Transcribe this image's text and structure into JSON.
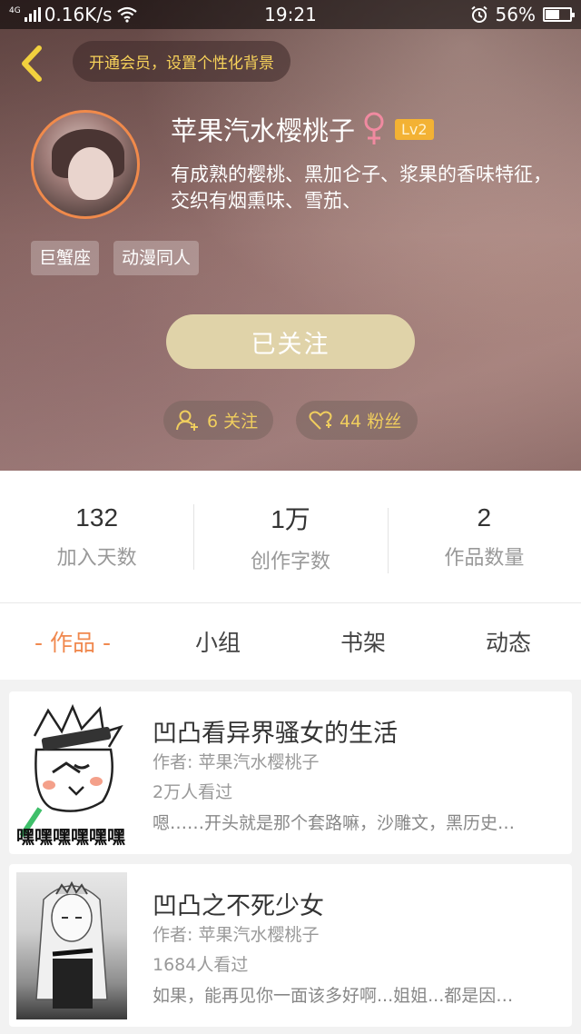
{
  "status_bar": {
    "network": "4G",
    "speed": "0.16K/s",
    "time": "19:21",
    "battery": "56%"
  },
  "header": {
    "vip_prompt": "开通会员，设置个性化背景",
    "username": "苹果汽水樱桃子",
    "level": "Lv2",
    "bio": "有成熟的樱桃、黑加仑子、浆果的香味特征，交织有烟熏味、雪茄、",
    "tags": [
      "巨蟹座",
      "动漫同人"
    ],
    "follow_button": "已关注",
    "following": "6 关注",
    "fans": "44 粉丝"
  },
  "stats": [
    {
      "value": "132",
      "label": "加入天数"
    },
    {
      "value": "1万",
      "label": "创作字数"
    },
    {
      "value": "2",
      "label": "作品数量"
    }
  ],
  "tabs": {
    "works": "- 作品 -",
    "groups": "小组",
    "bookshelf": "书架",
    "activity": "动态"
  },
  "works": [
    {
      "title": "凹凸看异界骚女的生活",
      "author": "作者: 苹果汽水樱桃子",
      "views": "2万人看过",
      "desc": "嗯……开头就是那个套路嘛，沙雕文，黑历史…",
      "cover_text": "嘿嘿嘿嘿嘿嘿"
    },
    {
      "title": "凹凸之不死少女",
      "author": "作者: 苹果汽水樱桃子",
      "views": "1684人看过",
      "desc": "如果，能再见你一面该多好啊...姐姐...都是因…"
    }
  ],
  "colors": {
    "accent": "#f0894f",
    "gold": "#f0ce5e",
    "follow_button": "#e0d3a9"
  }
}
